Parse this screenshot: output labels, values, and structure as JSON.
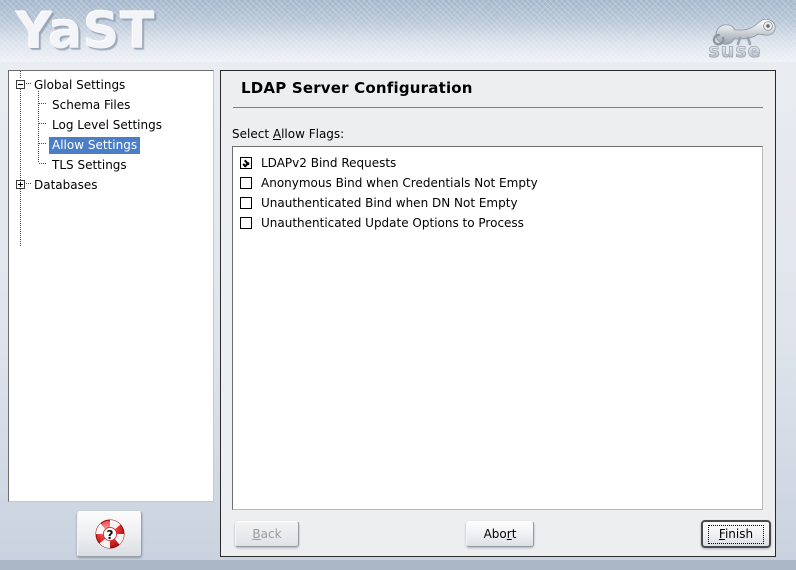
{
  "header": {
    "product_logo": "YaST",
    "vendor_logo_text": "suse",
    "vendor_icon": "chameleon-icon"
  },
  "tree": {
    "items": [
      {
        "label": "Global Settings",
        "level": 0,
        "expander": "minus",
        "selected": false
      },
      {
        "label": "Schema Files",
        "level": 1,
        "expander": "none",
        "selected": false
      },
      {
        "label": "Log Level Settings",
        "level": 1,
        "expander": "none",
        "selected": false
      },
      {
        "label": "Allow Settings",
        "level": 1,
        "expander": "none",
        "selected": true
      },
      {
        "label": "TLS Settings",
        "level": 1,
        "expander": "none",
        "selected": false
      },
      {
        "label": "Databases",
        "level": 0,
        "expander": "plus",
        "selected": false
      }
    ]
  },
  "help": {
    "icon": "life-ring-help-icon",
    "tooltip": "Help"
  },
  "main": {
    "title": "LDAP Server Configuration",
    "caption_prefix": "Select ",
    "caption_accel": "A",
    "caption_suffix": "llow Flags:",
    "flags": [
      {
        "label": "LDAPv2 Bind Requests",
        "checked": true
      },
      {
        "label": "Anonymous Bind when Credentials Not Empty",
        "checked": false
      },
      {
        "label": "Unauthenticated Bind when DN Not Empty",
        "checked": false
      },
      {
        "label": "Unauthenticated Update Options to Process",
        "checked": false
      }
    ]
  },
  "buttons": {
    "back": {
      "prefix": "",
      "accel": "B",
      "suffix": "ack",
      "disabled": true,
      "default": false
    },
    "abort": {
      "prefix": "Abo",
      "accel": "r",
      "suffix": "t",
      "disabled": false,
      "default": false
    },
    "finish": {
      "prefix": "",
      "accel": "F",
      "suffix": "inish",
      "disabled": false,
      "default": true
    }
  },
  "colors": {
    "selection_blue": "#4a7fc8",
    "panel_background": "#edeef0",
    "list_background": "#ffffff",
    "header_top": "#a4b7cc",
    "header_bottom": "#eef1f6",
    "bottom_strip": "#a9b6c6"
  }
}
